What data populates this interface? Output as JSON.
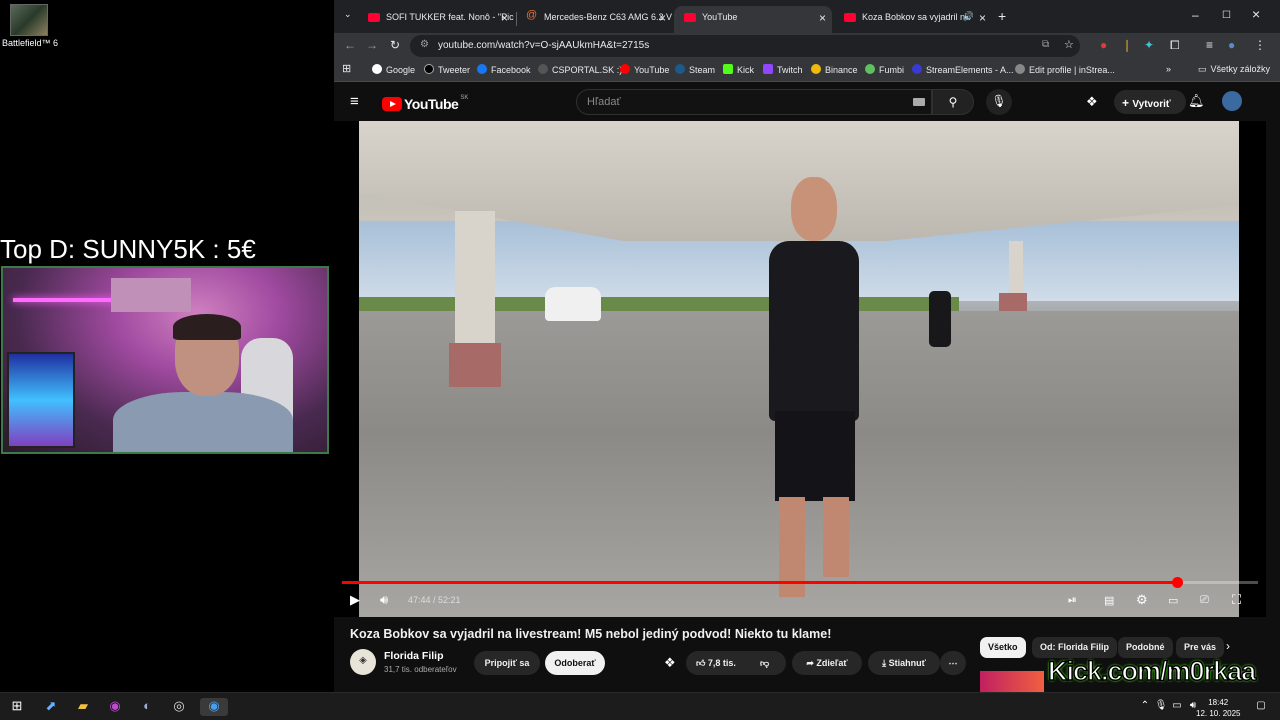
{
  "desktop": {
    "icon_label": "Battlefield™ 6",
    "donation_text": "Top D: SUNNY5K : 5€"
  },
  "browser": {
    "tabs": [
      {
        "title": "SOFI TUKKER feat. Nonô - \"Pick",
        "active": false
      },
      {
        "title": "Mercedes-Benz C63 AMG 6.2 V",
        "active": false
      },
      {
        "title": "YouTube",
        "active": true
      },
      {
        "title": "Koza Bobkov sa vyjadril na",
        "active": false
      }
    ],
    "url": "youtube.com/watch?v=O-sjAAUkmHA&t=2715s",
    "bookmarks": [
      "Google",
      "Tweeter",
      "Facebook",
      "CSPORTAL.SK :)",
      "YouTube",
      "Steam",
      "Kick",
      "Twitch",
      "Binance",
      "Fumbi",
      "StreamElements - A...",
      "Edit profile | inStrea..."
    ],
    "all_bookmarks": "Všetky záložky"
  },
  "youtube": {
    "logo": "YouTube",
    "country": "SK",
    "search_placeholder": "Hľadať",
    "create_label": "Vytvoriť",
    "player": {
      "time": "47:44 / 52:21",
      "progress": 0.912
    },
    "video_title": "Koza Bobkov sa vyjadril na livestream! M5 nebol jediný podvod! Niekto tu klame!",
    "channel_name": "Florida Filip",
    "channel_subs": "31,7 tis. odberateľov",
    "join_label": "Pripojiť sa",
    "subscribe_label": "Odoberať",
    "likes": "7,8 tis.",
    "share_label": "Zdieľať",
    "download_label": "Stiahnuť",
    "chips": [
      "Všetko",
      "Od: Florida Filip",
      "Podobné",
      "Pre vás"
    ]
  },
  "overlay": {
    "watermark": "Kick.com/m0rkaa"
  },
  "taskbar": {
    "time": "18:42",
    "date": "12. 10. 2025"
  }
}
